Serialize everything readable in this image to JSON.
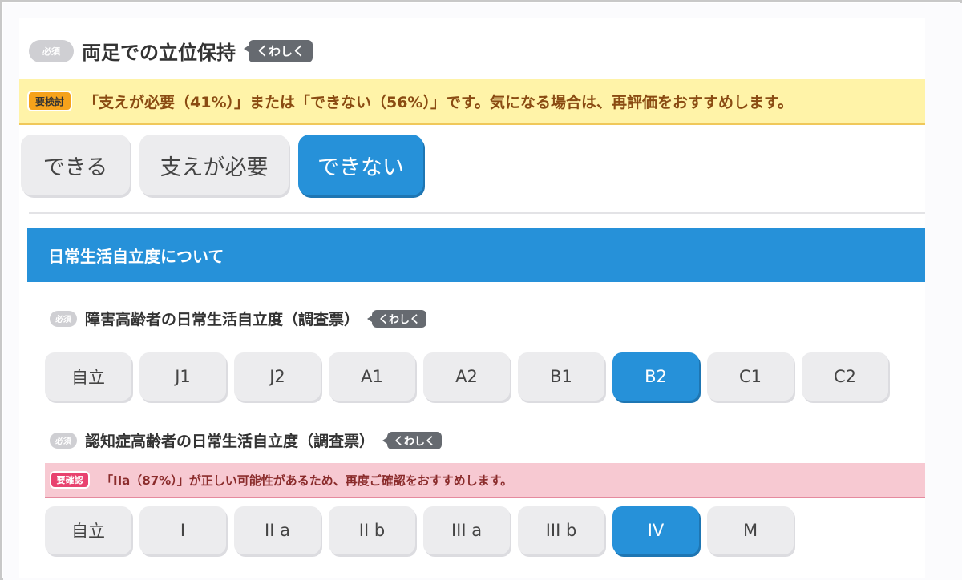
{
  "q1": {
    "required": "必須",
    "title": "両足での立位保持",
    "detail": "くわしく",
    "alert_badge": "要検討",
    "alert_text": "「支えが必要（41%）」または「できない（56%）」です。気になる場合は、再評価をおすすめします。",
    "options": [
      {
        "label": "できる",
        "selected": false
      },
      {
        "label": "支えが必要",
        "selected": false
      },
      {
        "label": "できない",
        "selected": true
      }
    ]
  },
  "section": {
    "title": "日常生活自立度について"
  },
  "q2": {
    "required": "必須",
    "title": "障害高齢者の日常生活自立度（調査票）",
    "detail": "くわしく",
    "options": [
      {
        "label": "自立",
        "selected": false
      },
      {
        "label": "J1",
        "selected": false
      },
      {
        "label": "J2",
        "selected": false
      },
      {
        "label": "A1",
        "selected": false
      },
      {
        "label": "A2",
        "selected": false
      },
      {
        "label": "B1",
        "selected": false
      },
      {
        "label": "B2",
        "selected": true
      },
      {
        "label": "C1",
        "selected": false
      },
      {
        "label": "C2",
        "selected": false
      }
    ]
  },
  "q3": {
    "required": "必須",
    "title": "認知症高齢者の日常生活自立度（調査票）",
    "detail": "くわしく",
    "alert_badge": "要確認",
    "alert_text": "「IIa（87%）」が正しい可能性があるため、再度ご確認をおすすめします。",
    "options": [
      {
        "label": "自立",
        "selected": false
      },
      {
        "label": "I",
        "selected": false
      },
      {
        "label": "II a",
        "selected": false
      },
      {
        "label": "II b",
        "selected": false
      },
      {
        "label": "III a",
        "selected": false
      },
      {
        "label": "III b",
        "selected": false
      },
      {
        "label": "IV",
        "selected": true
      },
      {
        "label": "M",
        "selected": false
      }
    ]
  },
  "colors": {
    "accent": "#2691d9",
    "alert_yellow": "#fff3a8",
    "alert_pink": "#f7c9d2",
    "badge_orange": "#f5a21b",
    "badge_pink": "#e8426f"
  }
}
